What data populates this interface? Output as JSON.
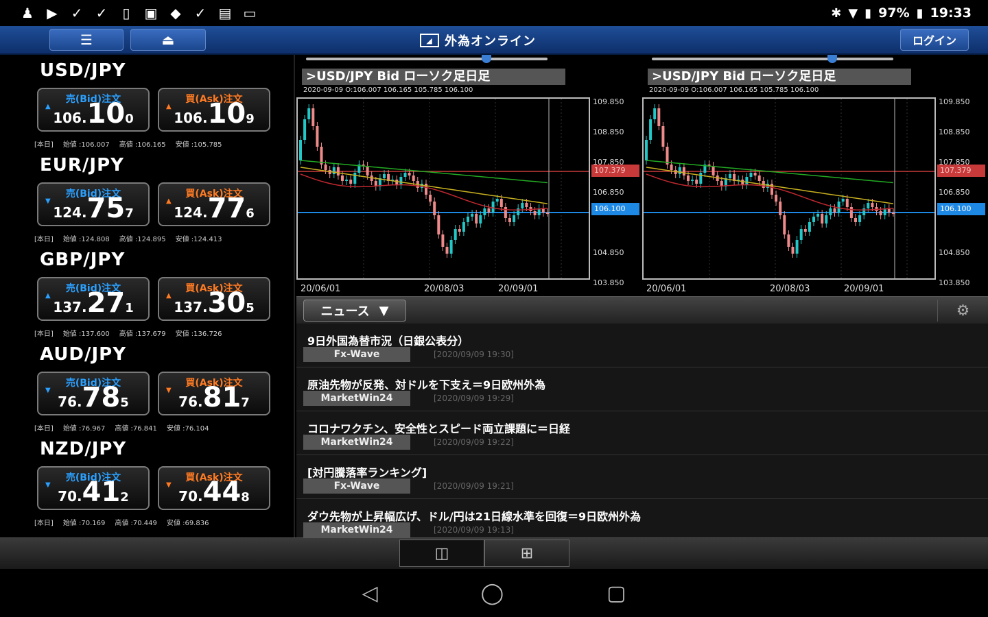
{
  "status_bar": {
    "left_icons": [
      "person-icon",
      "youtube-icon",
      "check-icon",
      "check-icon",
      "phone-icon",
      "image-icon",
      "dropbox-icon",
      "check-icon",
      "sim-icon",
      "cast-icon"
    ],
    "battery": "97%",
    "time": "19:33"
  },
  "header": {
    "menu_icon": "☰",
    "up_icon": "⏏",
    "logo_text": "外為オンライン",
    "login_label": "ログイン"
  },
  "pairs": [
    {
      "name": "USD/JPY",
      "bid_label": "売(Bid)注文",
      "ask_label": "買(Ask)注文",
      "bid_big": "106.",
      "bid_main": "10",
      "bid_small": "0",
      "ask_big": "106.",
      "ask_main": "10",
      "ask_small": "9",
      "bid_dir": "▲",
      "ask_dir": "▲",
      "info_prefix": "[本日]",
      "open": "始値 :106.007",
      "high": "高値 :106.165",
      "low": "安値 :105.785"
    },
    {
      "name": "EUR/JPY",
      "bid_label": "売(Bid)注文",
      "ask_label": "買(Ask)注文",
      "bid_big": "124.",
      "bid_main": "75",
      "bid_small": "7",
      "ask_big": "124.",
      "ask_main": "77",
      "ask_small": "6",
      "bid_dir": "▼",
      "ask_dir": "▲",
      "info_prefix": "[本日]",
      "open": "始値 :124.808",
      "high": "高値 :124.895",
      "low": "安値 :124.413"
    },
    {
      "name": "GBP/JPY",
      "bid_label": "売(Bid)注文",
      "ask_label": "買(Ask)注文",
      "bid_big": "137.",
      "bid_main": "27",
      "bid_small": "1",
      "ask_big": "137.",
      "ask_main": "30",
      "ask_small": "5",
      "bid_dir": "▲",
      "ask_dir": "▲",
      "info_prefix": "[本日]",
      "open": "始値 :137.600",
      "high": "高値 :137.679",
      "low": "安値 :136.726"
    },
    {
      "name": "AUD/JPY",
      "bid_label": "売(Bid)注文",
      "ask_label": "買(Ask)注文",
      "bid_big": "76.",
      "bid_main": "78",
      "bid_small": "5",
      "ask_big": "76.",
      "ask_main": "81",
      "ask_small": "7",
      "bid_dir": "▼",
      "ask_dir": "▼",
      "info_prefix": "[本日]",
      "open": "始値 :76.967",
      "high": "高値 :76.841",
      "low": "安値 :76.104"
    },
    {
      "name": "NZD/JPY",
      "bid_label": "売(Bid)注文",
      "ask_label": "買(Ask)注文",
      "bid_big": "70.",
      "bid_main": "41",
      "bid_small": "2",
      "ask_big": "70.",
      "ask_main": "44",
      "ask_small": "8",
      "bid_dir": "▼",
      "ask_dir": "▼",
      "info_prefix": "[本日]",
      "open": "始値 :70.169",
      "high": "高値 :70.449",
      "low": "安値 :69.836"
    }
  ],
  "charts": [
    {
      "title": ">USD/JPY Bid ローソク足日足",
      "ohlc": "2020-09-09  O:106.007  106.165  105.785  106.100",
      "y_ticks": [
        "109.850",
        "108.850",
        "107.850",
        "106.850",
        "104.850",
        "103.850"
      ],
      "red_line_label": "107.379",
      "blue_line_label": "106.100",
      "x_ticks": [
        "20/06/01",
        "20/08/03",
        "20/09/01"
      ]
    },
    {
      "title": ">USD/JPY Bid ローソク足日足",
      "ohlc": "2020-09-09  O:106.007  106.165  105.785  106.100",
      "y_ticks": [
        "109.850",
        "108.850",
        "107.850",
        "106.850",
        "104.850",
        "103.850"
      ],
      "red_line_label": "107.379",
      "blue_line_label": "106.100",
      "x_ticks": [
        "20/06/01",
        "20/08/03",
        "20/09/01"
      ]
    }
  ],
  "news": {
    "dropdown_label": "ニュース",
    "items": [
      {
        "title": "9日外国為替市況（日銀公表分）",
        "source": "Fx-Wave",
        "time": "[2020/09/09 19:30]"
      },
      {
        "title": "原油先物が反発、対ドルを下支え＝9日欧州外為",
        "source": "MarketWin24",
        "time": "[2020/09/09 19:29]"
      },
      {
        "title": "コロナワクチン、安全性とスピード両立課題に＝日経",
        "source": "MarketWin24",
        "time": "[2020/09/09 19:22]"
      },
      {
        "title": "[対円騰落率ランキング]",
        "source": "Fx-Wave",
        "time": "[2020/09/09 19:21]"
      },
      {
        "title": "ダウ先物が上昇幅広げ、ドル/円は21日線水準を回復＝9日欧州外為",
        "source": "MarketWin24",
        "time": "[2020/09/09 19:13]"
      }
    ]
  },
  "bottom_tabs": [
    "layout-single-icon",
    "layout-grid-icon"
  ],
  "colors": {
    "accent_blue": "#2aa0ff",
    "accent_orange": "#ff7a22",
    "header_blue": "#1f4e98",
    "red_line": "#c83a3a",
    "blue_line": "#1e88e5"
  }
}
